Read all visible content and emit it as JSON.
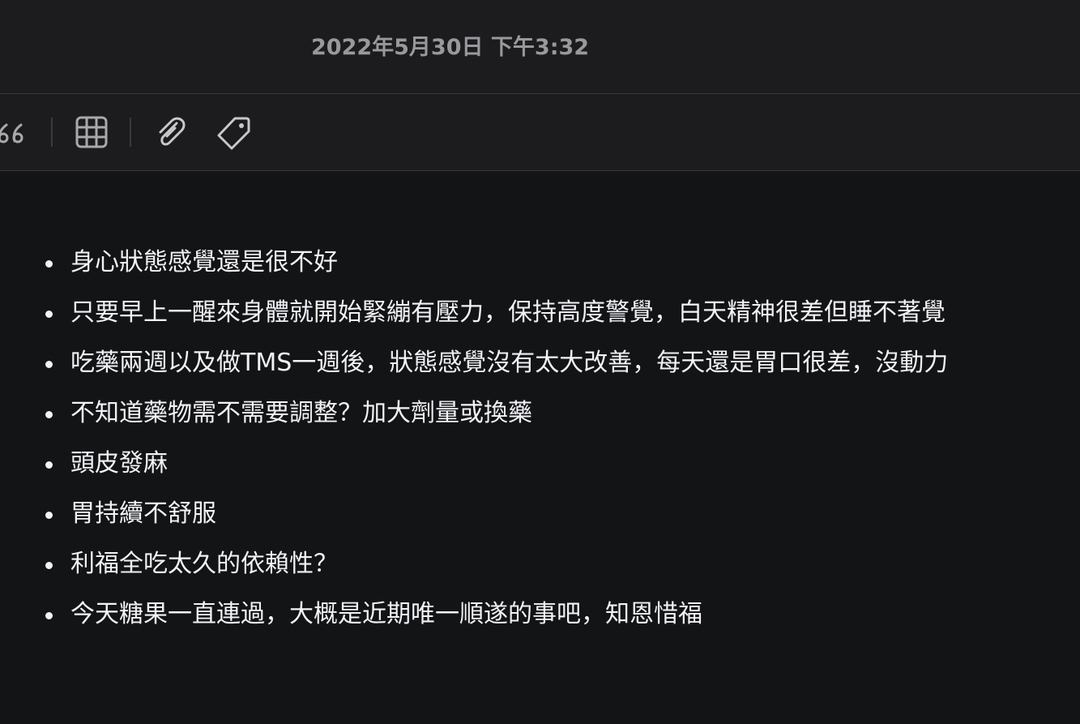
{
  "header": {
    "timestamp": "2022年5月30日 下午3:32"
  },
  "toolbar": {
    "tools": [
      {
        "icon": "quote-icon"
      },
      {
        "icon": "table-icon"
      },
      {
        "icon": "paperclip-icon"
      },
      {
        "icon": "tag-icon"
      }
    ]
  },
  "note": {
    "items": [
      "身心狀態感覺還是很不好",
      "只要早上一醒來身體就開始緊繃有壓力，保持高度警覺，白天精神很差但睡不著覺",
      "吃藥兩週以及做TMS一週後，狀態感覺沒有太大改善，每天還是胃口很差，沒動力",
      "不知道藥物需不需要調整？加大劑量或換藥",
      "頭皮發麻",
      "胃持續不舒服",
      "利福全吃太久的依賴性？",
      "今天糖果一直連過，大概是近期唯一順遂的事吧，知恩惜福"
    ]
  },
  "colors": {
    "background": "#131416",
    "bar": "#1c1c1e",
    "text": "#f2f2f7",
    "muted": "#98989d"
  }
}
